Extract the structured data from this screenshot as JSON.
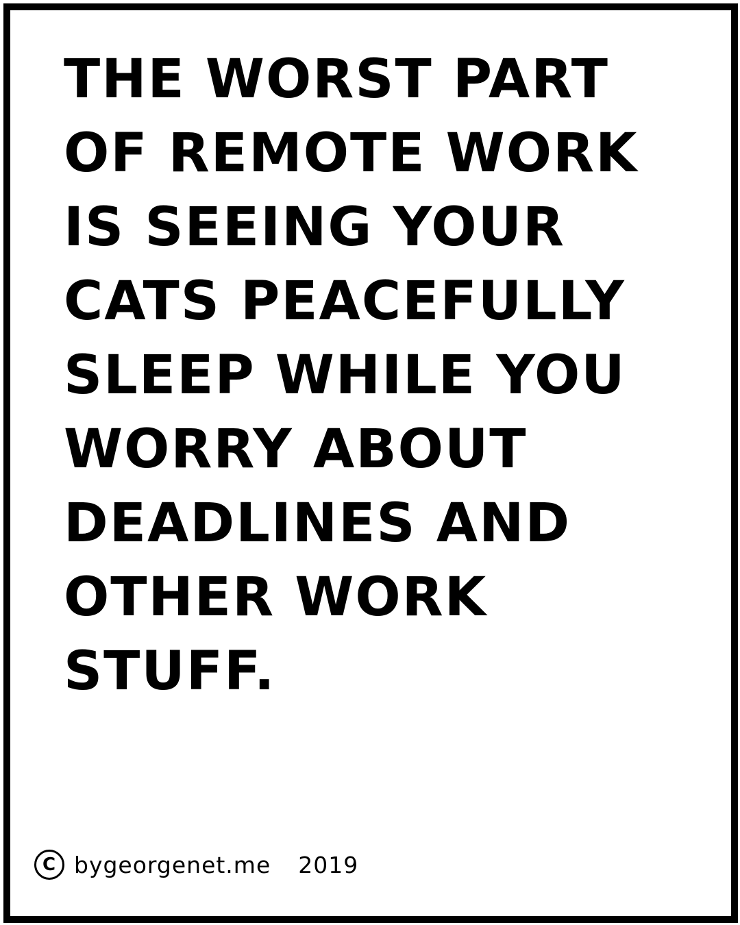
{
  "caption": {
    "lines": [
      "THE WORST PART",
      "OF REMOTE WORK",
      "IS SEEING YOUR",
      "CATS PEACEFULLY",
      "SLEEP WHILE YOU",
      "WORRY ABOUT",
      "DEADLINES AND",
      "OTHER WORK",
      "STUFF."
    ]
  },
  "footer": {
    "icon": "copyright-icon",
    "icon_glyph": "C",
    "site": "bygeorgenet.me",
    "year": "2019"
  },
  "colors": {
    "border": "#000000",
    "background": "#ffffff",
    "text": "#000000"
  }
}
